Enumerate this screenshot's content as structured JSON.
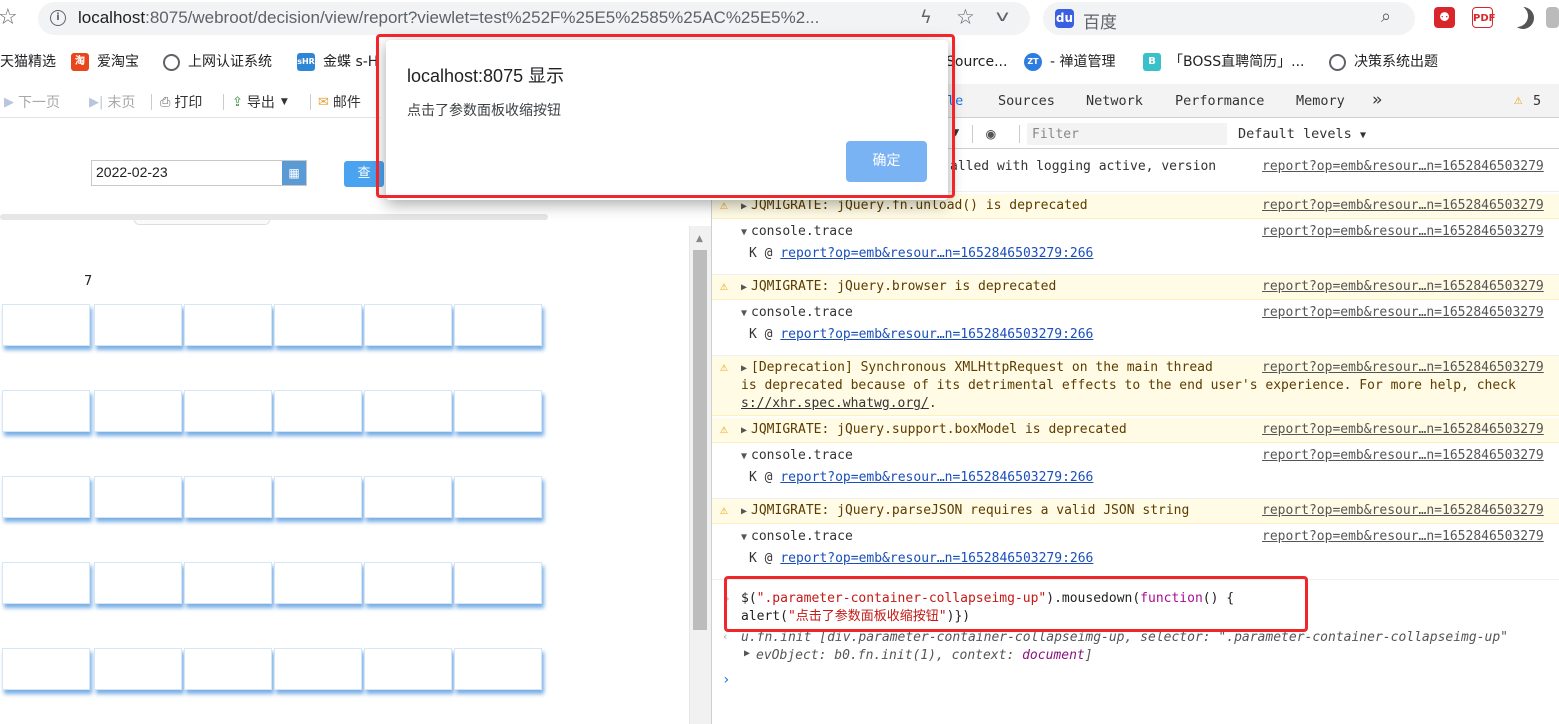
{
  "browser": {
    "url_host": "localhost",
    "url_rest": ":8075/webroot/decision/view/report?viewlet=test%252F%25E5%2585%25AC%25E5%2...",
    "search_engine": "百度"
  },
  "bookmarks": [
    {
      "label": "天猫精选",
      "icon": "tmall-icon",
      "color": "#ffffff"
    },
    {
      "label": "爱淘宝",
      "icon": "taobao-icon",
      "icon_text": "淘",
      "color": "#e8461c"
    },
    {
      "label": "上网认证系统",
      "icon": "globe-icon"
    },
    {
      "label": "金蝶 s-H",
      "icon": "kingdee-icon",
      "icon_text": "sHR",
      "color": "#2f86d6"
    },
    {
      "label": "Source...",
      "icon": "source-icon"
    },
    {
      "label": "- 禅道管理",
      "icon": "zentao-icon",
      "icon_text": "ZT",
      "color": "#2d7de0"
    },
    {
      "label": "「BOSS直聘简历」...",
      "icon": "boss-icon",
      "icon_text": "B",
      "color": "#39c0c8"
    },
    {
      "label": "决策系统出题",
      "icon": "globe-icon"
    }
  ],
  "report_toolbar": {
    "next_page": "下一页",
    "last_page": "末页",
    "print": "打印",
    "export": "导出",
    "mail": "邮件"
  },
  "parameters": {
    "date_value": "2022-02-23",
    "query_label": "查"
  },
  "report": {
    "number": "7"
  },
  "devtools": {
    "tabs": [
      "Console",
      "Sources",
      "Network",
      "Performance",
      "Memory"
    ],
    "console_tab_partial": "le",
    "warning_count": "5",
    "filter_placeholder": "Filter",
    "levels": "Default levels",
    "messages": [
      {
        "text": "alled with logging active, version",
        "src": "report?op=emb&resour…n=1652846503279"
      },
      {
        "text": "JQMIGRATE: jQuery.fn.unload() is deprecated",
        "src": "report?op=emb&resour…n=1652846503279",
        "trace": "console.trace",
        "trace_src": "report?op=emb&resour…n=1652846503279",
        "link": "report?op=emb&resour…n=1652846503279:266"
      },
      {
        "text": "JQMIGRATE: jQuery.browser is deprecated",
        "src": "report?op=emb&resour…n=1652846503279",
        "trace": "console.trace",
        "trace_src": "report?op=emb&resour…n=1652846503279",
        "link": "report?op=emb&resour…n=1652846503279:266"
      },
      {
        "text": "[Deprecation] Synchronous XMLHttpRequest on the main thread",
        "src": "report?op=emb&resour…n=1652846503279",
        "line2": "is deprecated because of its detrimental effects to the end user's experience. For more help, check",
        "line3_link": "s://xhr.spec.whatwg.org/",
        "line3_tail": "."
      },
      {
        "text": "JQMIGRATE: jQuery.support.boxModel is deprecated",
        "src": "report?op=emb&resour…n=1652846503279",
        "trace": "console.trace",
        "trace_src": "report?op=emb&resour…n=1652846503279",
        "link": "report?op=emb&resour…n=1652846503279:266"
      },
      {
        "text": "JQMIGRATE: jQuery.parseJSON requires a valid JSON string",
        "src": "report?op=emb&resour…n=1652846503279",
        "trace": "console.trace",
        "trace_src": "report?op=emb&resour…n=1652846503279",
        "link": "report?op=emb&resour…n=1652846503279:266"
      }
    ],
    "command": {
      "l1_pre": "$(",
      "l1_str": "\".parameter-container-collapseimg-up\"",
      "l1_mid": ").mousedown(",
      "l1_kw": "function",
      "l1_post": "() {",
      "l2_pre": "alert(",
      "l2_str": "\"点击了参数面板收缩按钮\"",
      "l2_post": ")})"
    },
    "result_line1": "u.fn.init [div.parameter-container-collapseimg-up, selector: \".parameter-container-collapseimg-up\"",
    "result_line2_a": "evObject: b0.fn.init(1), context: ",
    "result_line2_kw": "document",
    "result_line2_b": "]"
  },
  "alert": {
    "title": "localhost:8075 显示",
    "message": "点击了参数面板收缩按钮",
    "ok_label": "确定"
  },
  "colors": {
    "highlight": "#f0262a",
    "ok_button": "#7ab3f3",
    "cell_shadow": "#78aee6"
  }
}
